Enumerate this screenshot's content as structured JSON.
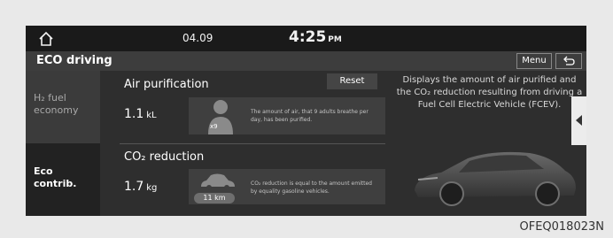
{
  "statusbar": {
    "home_icon": "home-icon",
    "date": "04.09",
    "time": "4:25",
    "ampm": "PM"
  },
  "titlebar": {
    "title": "ECO driving",
    "menu_label": "Menu",
    "back_icon": "back-icon"
  },
  "sidebar": {
    "items": [
      {
        "label_line1": "H₂ fuel",
        "label_line2": "economy",
        "selected": false
      },
      {
        "label_line1": "Eco",
        "label_line2": "contrib.",
        "selected": true
      }
    ]
  },
  "air": {
    "title": "Air purification",
    "reset_label": "Reset",
    "value": "1.1",
    "unit": "kL",
    "badge": "x9",
    "info": "The amount of air, that 9 adults breathe per day, has been purified."
  },
  "co2": {
    "title": "CO₂ reduction",
    "value": "1.7",
    "unit": "kg",
    "badge": "11 km",
    "info": "CO₂ reduction is equal to the amount emitted by equality gasoline vehicles."
  },
  "description": "Displays the amount of air purified and the CO₂ reduction resulting from driving a Fuel Cell Electric Vehicle (FCEV).",
  "caption": "OFEQ018023N"
}
